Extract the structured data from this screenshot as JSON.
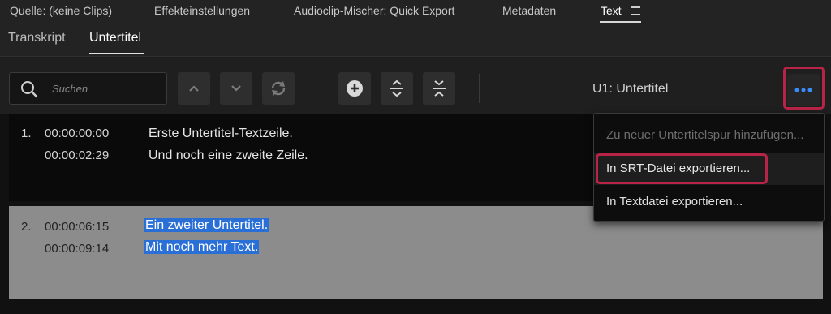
{
  "panel_tabs": [
    {
      "label": "Quelle: (keine Clips)"
    },
    {
      "label": "Effekteinstellungen"
    },
    {
      "label": "Audioclip-Mischer: Quick Export"
    },
    {
      "label": "Metadaten"
    },
    {
      "label": "Text",
      "active": true
    }
  ],
  "sub_tabs": [
    {
      "label": "Transkript"
    },
    {
      "label": "Untertitel",
      "active": true
    }
  ],
  "toolbar": {
    "search_placeholder": "Suchen",
    "track_label": "U1: Untertitel",
    "buttons": [
      "chevron-up-icon",
      "chevron-down-icon",
      "sync-icon",
      "add-icon",
      "expand-icon",
      "merge-icon",
      "more-icon"
    ]
  },
  "captions": [
    {
      "number": "1.",
      "start": "00:00:00:00",
      "end": "00:00:02:29",
      "line1": "Erste Untertitel-Textzeile.",
      "line2": "Und noch eine zweite Zeile."
    },
    {
      "number": "2.",
      "start": "00:00:06:15",
      "end": "00:00:09:14",
      "line1": "Ein zweiter Untertitel.",
      "line2": "Mit noch mehr Text.",
      "selected": true
    }
  ],
  "menu": {
    "items": [
      {
        "label": "Zu neuer Untertitelspur hinzufügen...",
        "disabled": true
      },
      {
        "label": "In SRT-Datei exportieren...",
        "highlighted": true
      },
      {
        "label": "In Textdatei exportieren..."
      }
    ]
  },
  "colors": {
    "accent_blue": "#2a6fd6",
    "highlight_red": "#b82447",
    "more_dots": "#3a8bff"
  }
}
